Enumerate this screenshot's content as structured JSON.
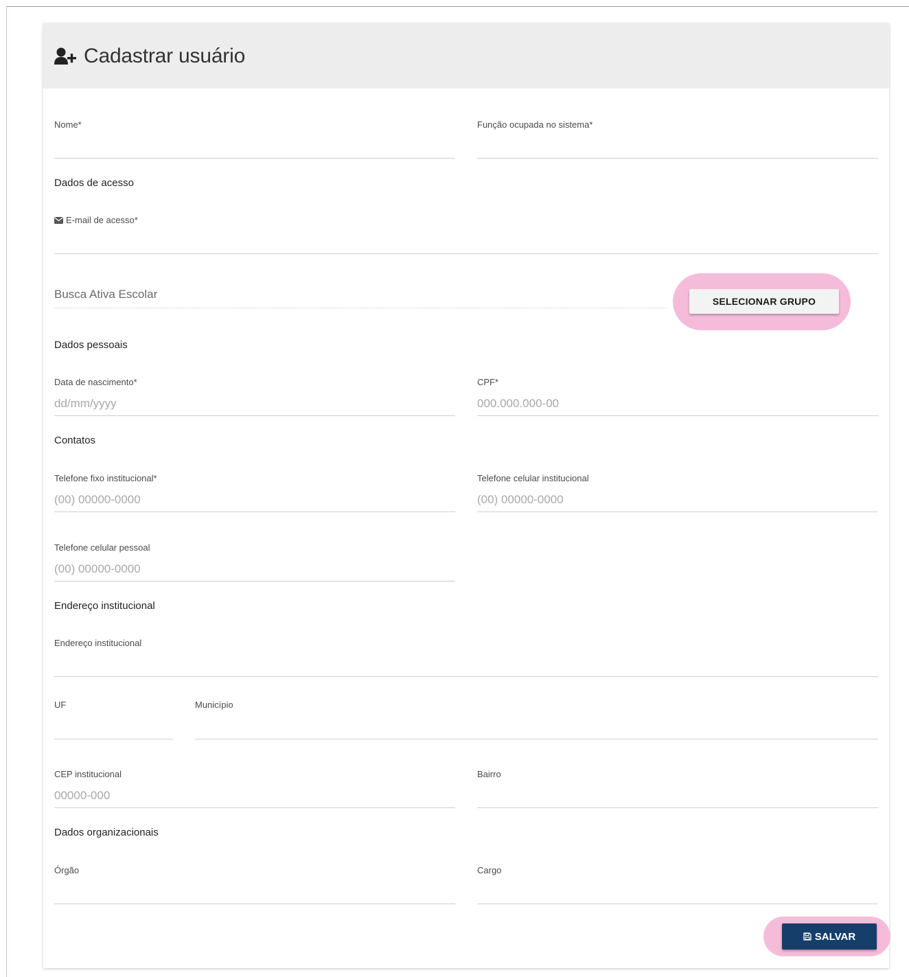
{
  "header": {
    "title": "Cadastrar usuário",
    "icon": "user-plus-icon"
  },
  "fields": {
    "nome": {
      "label": "Nome*",
      "value": ""
    },
    "funcao": {
      "label": "Função ocupada no sistema*",
      "value": ""
    },
    "email": {
      "label": "E-mail de acesso*",
      "value": "",
      "icon": "envelope-icon"
    },
    "grupo": {
      "value": "Busca Ativa Escolar"
    },
    "nascimento": {
      "label": "Data de nascimento*",
      "placeholder": "dd/mm/yyyy"
    },
    "cpf": {
      "label": "CPF*",
      "placeholder": "000.000.000-00"
    },
    "tel_fixo": {
      "label": "Telefone fixo institucional*",
      "placeholder": "(00) 00000-0000"
    },
    "tel_cel_inst": {
      "label": "Telefone celular institucional",
      "placeholder": "(00) 00000-0000"
    },
    "tel_cel_pessoal": {
      "label": "Telefone celular pessoal",
      "placeholder": "(00) 00000-0000"
    },
    "endereco": {
      "label": "Endereço institucional",
      "value": ""
    },
    "uf": {
      "label": "UF",
      "value": ""
    },
    "municipio": {
      "label": "Município",
      "value": ""
    },
    "cep": {
      "label": "CEP institucional",
      "placeholder": "00000-000"
    },
    "bairro": {
      "label": "Bairro",
      "value": ""
    },
    "orgao": {
      "label": "Órgão",
      "value": ""
    },
    "cargo": {
      "label": "Cargo",
      "value": ""
    }
  },
  "sections": {
    "acesso": "Dados de acesso",
    "pessoais": "Dados pessoais",
    "contatos": "Contatos",
    "endereco": "Endereço institucional",
    "organizacionais": "Dados organizacionais"
  },
  "buttons": {
    "select_group": "SELECIONAR GRUPO",
    "save": "SALVAR",
    "save_icon": "floppy-disk-icon"
  },
  "colors": {
    "header_bg": "#ededed",
    "primary": "#163e6b",
    "highlight": "#f5bcd9"
  }
}
